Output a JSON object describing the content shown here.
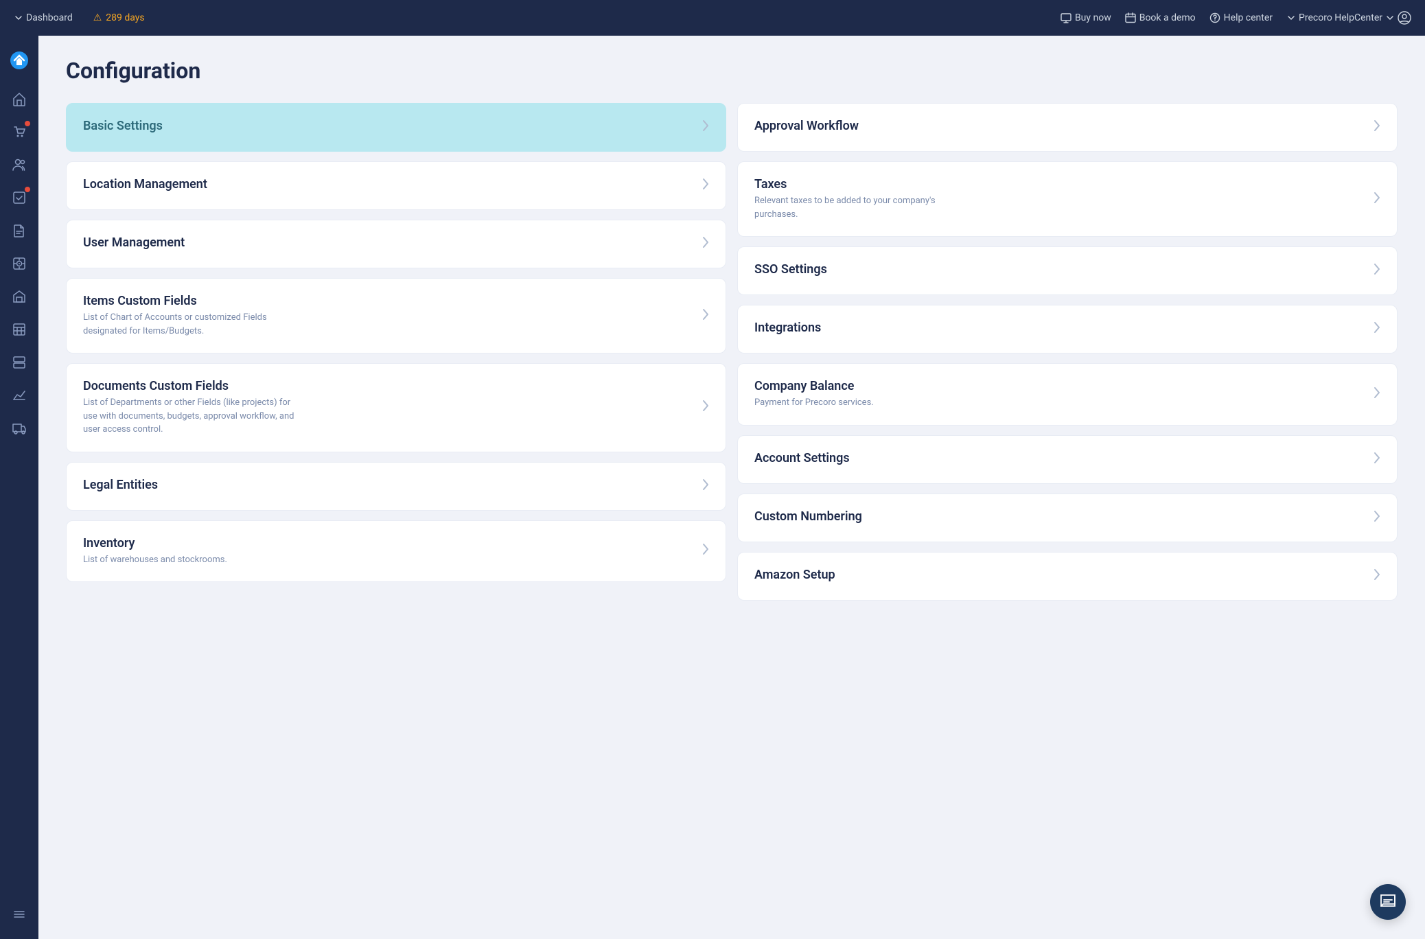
{
  "topnav": {
    "dashboard_label": "Dashboard",
    "days_warning": "289 days",
    "buy_now": "Buy now",
    "book_demo": "Book a demo",
    "help_center": "Help center",
    "company": "Precoro HelpCenter"
  },
  "page": {
    "title": "Configuration"
  },
  "left_cards": [
    {
      "id": "basic-settings",
      "title": "Basic Settings",
      "desc": "",
      "active": true
    },
    {
      "id": "location-management",
      "title": "Location Management",
      "desc": "",
      "active": false
    },
    {
      "id": "user-management",
      "title": "User Management",
      "desc": "",
      "active": false
    },
    {
      "id": "items-custom-fields",
      "title": "Items Custom Fields",
      "desc": "List of Chart of Accounts or customized Fields designated for Items/Budgets.",
      "active": false
    },
    {
      "id": "documents-custom-fields",
      "title": "Documents Custom Fields",
      "desc": "List of Departments or other Fields (like projects) for use with documents, budgets, approval workflow, and user access control.",
      "active": false
    },
    {
      "id": "legal-entities",
      "title": "Legal Entities",
      "desc": "",
      "active": false
    },
    {
      "id": "inventory",
      "title": "Inventory",
      "desc": "List of warehouses and stockrooms.",
      "active": false
    }
  ],
  "right_cards": [
    {
      "id": "approval-workflow",
      "title": "Approval Workflow",
      "desc": "",
      "active": false
    },
    {
      "id": "taxes",
      "title": "Taxes",
      "desc": "Relevant taxes to be added to your company's purchases.",
      "active": false
    },
    {
      "id": "sso-settings",
      "title": "SSO Settings",
      "desc": "",
      "active": false
    },
    {
      "id": "integrations",
      "title": "Integrations",
      "desc": "",
      "active": false
    },
    {
      "id": "company-balance",
      "title": "Company Balance",
      "desc": "Payment for Precoro services.",
      "active": false
    },
    {
      "id": "account-settings",
      "title": "Account Settings",
      "desc": "",
      "active": false
    },
    {
      "id": "custom-numbering",
      "title": "Custom Numbering",
      "desc": "",
      "active": false
    },
    {
      "id": "amazon-setup",
      "title": "Amazon Setup",
      "desc": "",
      "active": false
    }
  ]
}
